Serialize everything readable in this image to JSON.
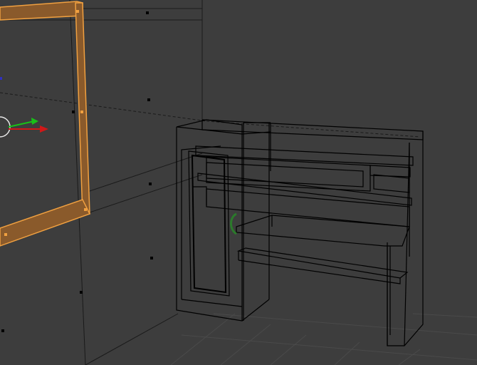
{
  "viewport": {
    "mode": "wireframe",
    "colors": {
      "background": "#3d3d3d",
      "wire": "#000000",
      "grid": "#4a4a4a",
      "selected_face": "#8a5a2b",
      "selected_edge": "#f0a040",
      "x_axis": "#d01818",
      "y_axis": "#18c018",
      "z_axis": "#3030c0",
      "handle": "#2b7a2b"
    },
    "selected_object": "window-frame",
    "manipulator": {
      "icon": "translate-manipulator-icon",
      "axes": [
        "x",
        "y"
      ]
    }
  }
}
